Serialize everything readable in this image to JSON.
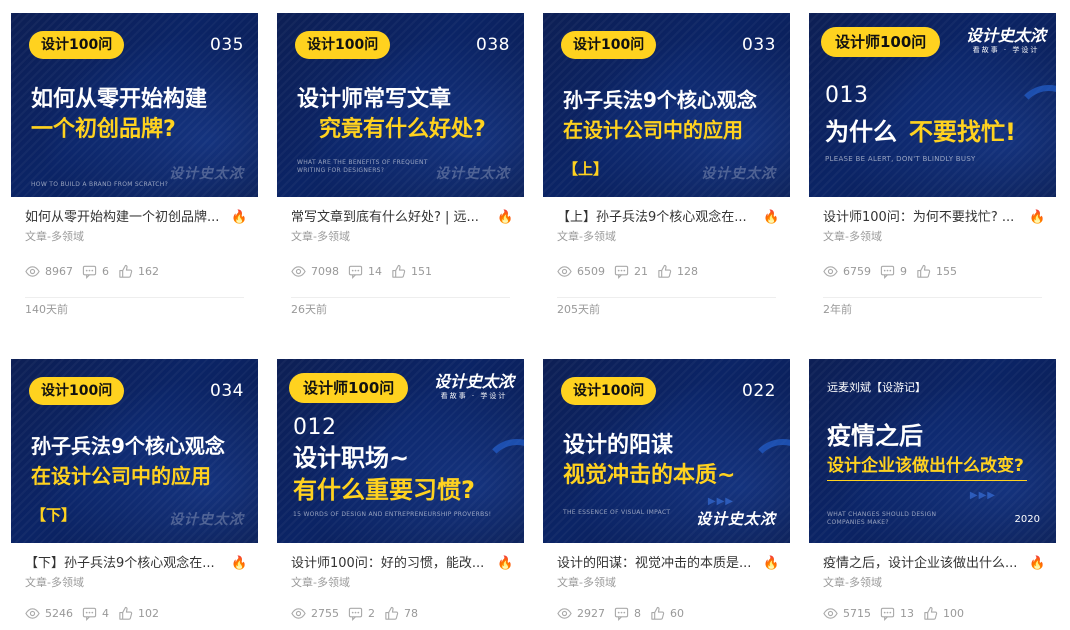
{
  "cards": [
    {
      "tag": "设计100问",
      "number": "035",
      "title1": "如何从零开始构建",
      "title2": "一个初创品牌?",
      "subtitle": "HOW TO BUILD A BRAND FROM SCRATCH?",
      "watermark": "设计史太浓",
      "caption": "如何从零开始构建一个初创品牌...",
      "category": "文章-多领域",
      "views": "8967",
      "comments": "6",
      "likes": "162",
      "date": "140天前"
    },
    {
      "tag": "设计100问",
      "number": "038",
      "title1": "设计师常写文章",
      "title2": "究竟有什么好处?",
      "subtitle": "WHAT ARE THE BENEFITS OF FREQUENT WRITING FOR DESIGNERS?",
      "watermark": "设计史太浓",
      "caption": "常写文章到底有什么好处? | 远...",
      "category": "文章-多领域",
      "views": "7098",
      "comments": "14",
      "likes": "151",
      "date": "26天前"
    },
    {
      "tag": "设计100问",
      "number": "033",
      "title1": "孙子兵法9个核心观念",
      "title2": "在设计公司中的应用",
      "bracket": "【上】",
      "watermark": "设计史太浓",
      "caption": "【上】孙子兵法9个核心观念在...",
      "category": "文章-多领域",
      "views": "6509",
      "comments": "21",
      "likes": "128",
      "date": "205天前"
    },
    {
      "tag": "设计师100问",
      "number": "013",
      "title1": "为什么",
      "title2": "不要找忙!",
      "subtitle": "PLEASE BE ALERT, DON'T BLINDLY BUSY",
      "logo": "设计史太浓",
      "logo_sub": "看故事 · 学设计",
      "caption": "设计师100问：为何不要找忙? ...",
      "category": "文章-多领域",
      "views": "6759",
      "comments": "9",
      "likes": "155",
      "date": "2年前"
    },
    {
      "tag": "设计100问",
      "number": "034",
      "title1": "孙子兵法9个核心观念",
      "title2": "在设计公司中的应用",
      "bracket": "【下】",
      "watermark": "设计史太浓",
      "caption": "【下】孙子兵法9个核心观念在...",
      "category": "文章-多领域",
      "views": "5246",
      "comments": "4",
      "likes": "102"
    },
    {
      "tag": "设计师100问",
      "number": "012",
      "title1": "设计职场~",
      "title2": "有什么重要习惯?",
      "subtitle": "15 WORDS OF DESIGN AND ENTREPRENEURSHIP PROVERBS!",
      "logo": "设计史太浓",
      "logo_sub": "看故事 · 学设计",
      "caption": "设计师100问：好的习惯，能改...",
      "category": "文章-多领域",
      "views": "2755",
      "comments": "2",
      "likes": "78"
    },
    {
      "tag": "设计100问",
      "number": "022",
      "title1": "设计的阳谋",
      "title2": "视觉冲击的本质~",
      "subtitle": "THE ESSENCE OF VISUAL IMPACT",
      "watermark": "设计史太浓",
      "caption": "设计的阳谋：视觉冲击的本质是...",
      "category": "文章-多领域",
      "views": "2927",
      "comments": "8",
      "likes": "60"
    },
    {
      "top_text": "远麦刘斌【设游记】",
      "title1": "疫情之后",
      "title2": "设计企业该做出什么改变?",
      "subtitle": "WHAT CHANGES SHOULD DESIGN COMPANIES MAKE?",
      "year": "2020",
      "caption": "疫情之后，设计企业该做出什么...",
      "category": "文章-多领域",
      "views": "5715",
      "comments": "13",
      "likes": "100"
    }
  ],
  "colors": {
    "accent_yellow": "#ffd21f",
    "card_navy": "#0b2466",
    "fire": "#f35b30",
    "muted": "#999999"
  }
}
